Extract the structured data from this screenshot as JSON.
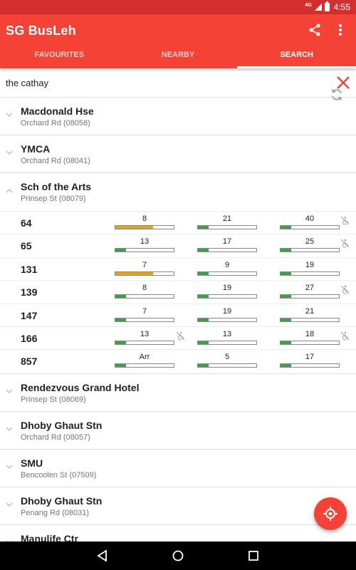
{
  "status_bar": {
    "network": "4G",
    "time": "4:55"
  },
  "app": {
    "title": "SG BusLeh"
  },
  "tabs": [
    {
      "label": "FAVOURITES",
      "active": false
    },
    {
      "label": "NEARBY",
      "active": false
    },
    {
      "label": "SEARCH",
      "active": true
    }
  ],
  "search": {
    "value": "the cathay",
    "placeholder": ""
  },
  "colors": {
    "primary": "#f44336",
    "primary_dark": "#d32f2f",
    "load_low": "#3ca04a",
    "load_medium": "#e3a21a"
  },
  "stops_before": [
    {
      "name": "Macdonald Hse",
      "address": "Orchard Rd (08058)"
    },
    {
      "name": "YMCA",
      "address": "Orchard Rd (08041)"
    }
  ],
  "expanded_stop": {
    "name": "Sch of the Arts",
    "address": "Prinsep St (08079)",
    "services": [
      {
        "no": "64",
        "arrivals": [
          {
            "text": "8",
            "load": 0.65,
            "level": "medium",
            "wheelchair": false
          },
          {
            "text": "21",
            "load": 0.18,
            "level": "low",
            "wheelchair": false
          },
          {
            "text": "40",
            "load": 0.18,
            "level": "low",
            "wheelchair": true
          }
        ]
      },
      {
        "no": "65",
        "arrivals": [
          {
            "text": "13",
            "load": 0.18,
            "level": "low",
            "wheelchair": false
          },
          {
            "text": "17",
            "load": 0.18,
            "level": "low",
            "wheelchair": false
          },
          {
            "text": "25",
            "load": 0.18,
            "level": "low",
            "wheelchair": true
          }
        ]
      },
      {
        "no": "131",
        "arrivals": [
          {
            "text": "7",
            "load": 0.65,
            "level": "medium",
            "wheelchair": false
          },
          {
            "text": "9",
            "load": 0.18,
            "level": "low",
            "wheelchair": false
          },
          {
            "text": "19",
            "load": 0.18,
            "level": "low",
            "wheelchair": false
          }
        ]
      },
      {
        "no": "139",
        "arrivals": [
          {
            "text": "8",
            "load": 0.18,
            "level": "low",
            "wheelchair": false
          },
          {
            "text": "19",
            "load": 0.18,
            "level": "low",
            "wheelchair": false
          },
          {
            "text": "27",
            "load": 0.18,
            "level": "low",
            "wheelchair": true
          }
        ]
      },
      {
        "no": "147",
        "arrivals": [
          {
            "text": "7",
            "load": 0.18,
            "level": "low",
            "wheelchair": false
          },
          {
            "text": "19",
            "load": 0.18,
            "level": "low",
            "wheelchair": false
          },
          {
            "text": "21",
            "load": 0.18,
            "level": "low",
            "wheelchair": false
          }
        ]
      },
      {
        "no": "166",
        "arrivals": [
          {
            "text": "13",
            "load": 0.18,
            "level": "low",
            "wheelchair": true
          },
          {
            "text": "13",
            "load": 0.18,
            "level": "low",
            "wheelchair": false
          },
          {
            "text": "18",
            "load": 0.18,
            "level": "low",
            "wheelchair": true
          }
        ]
      },
      {
        "no": "857",
        "arrivals": [
          {
            "text": "Arr",
            "load": 0.18,
            "level": "low",
            "wheelchair": false
          },
          {
            "text": "5",
            "load": 0.18,
            "level": "low",
            "wheelchair": false
          },
          {
            "text": "17",
            "load": 0.18,
            "level": "low",
            "wheelchair": false
          }
        ]
      }
    ]
  },
  "stops_after": [
    {
      "name": "Rendezvous Grand Hotel",
      "address": "Prinsep St (08069)"
    },
    {
      "name": "Dhoby Ghaut Stn",
      "address": "Orchard Rd (08057)"
    },
    {
      "name": "SMU",
      "address": "Bencoolen St (07509)"
    },
    {
      "name": "Dhoby Ghaut Stn",
      "address": "Penang Rd (08031)"
    },
    {
      "name": "Manulife Ctr",
      "address": ""
    }
  ]
}
